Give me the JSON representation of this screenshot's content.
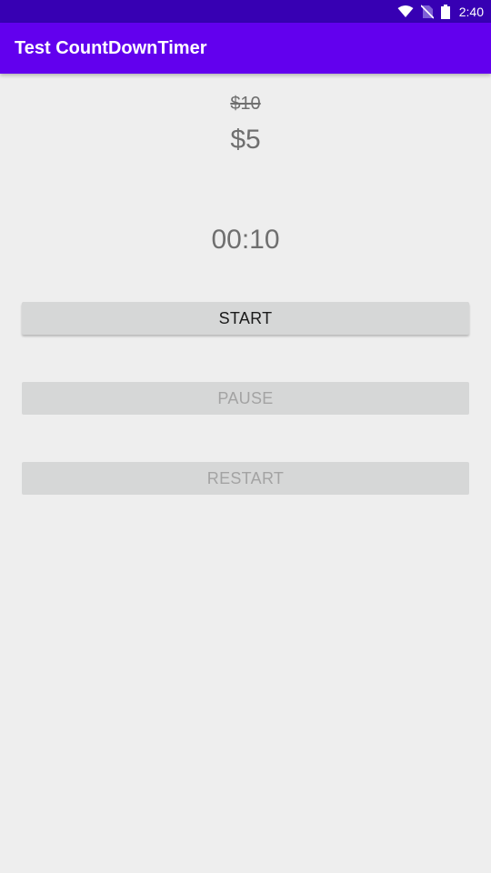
{
  "status_bar": {
    "time": "2:40",
    "icons": [
      "wifi-icon",
      "no-sim-icon",
      "battery-icon"
    ],
    "color": "#3700b3"
  },
  "app_bar": {
    "title": "Test CountDownTimer",
    "color": "#6200ee"
  },
  "price": {
    "original": "$10",
    "discounted": "$5"
  },
  "timer": {
    "display": "00:10"
  },
  "buttons": {
    "start": {
      "label": "START",
      "enabled": true
    },
    "pause": {
      "label": "PAUSE",
      "enabled": false
    },
    "restart": {
      "label": "RESTART",
      "enabled": false
    }
  }
}
